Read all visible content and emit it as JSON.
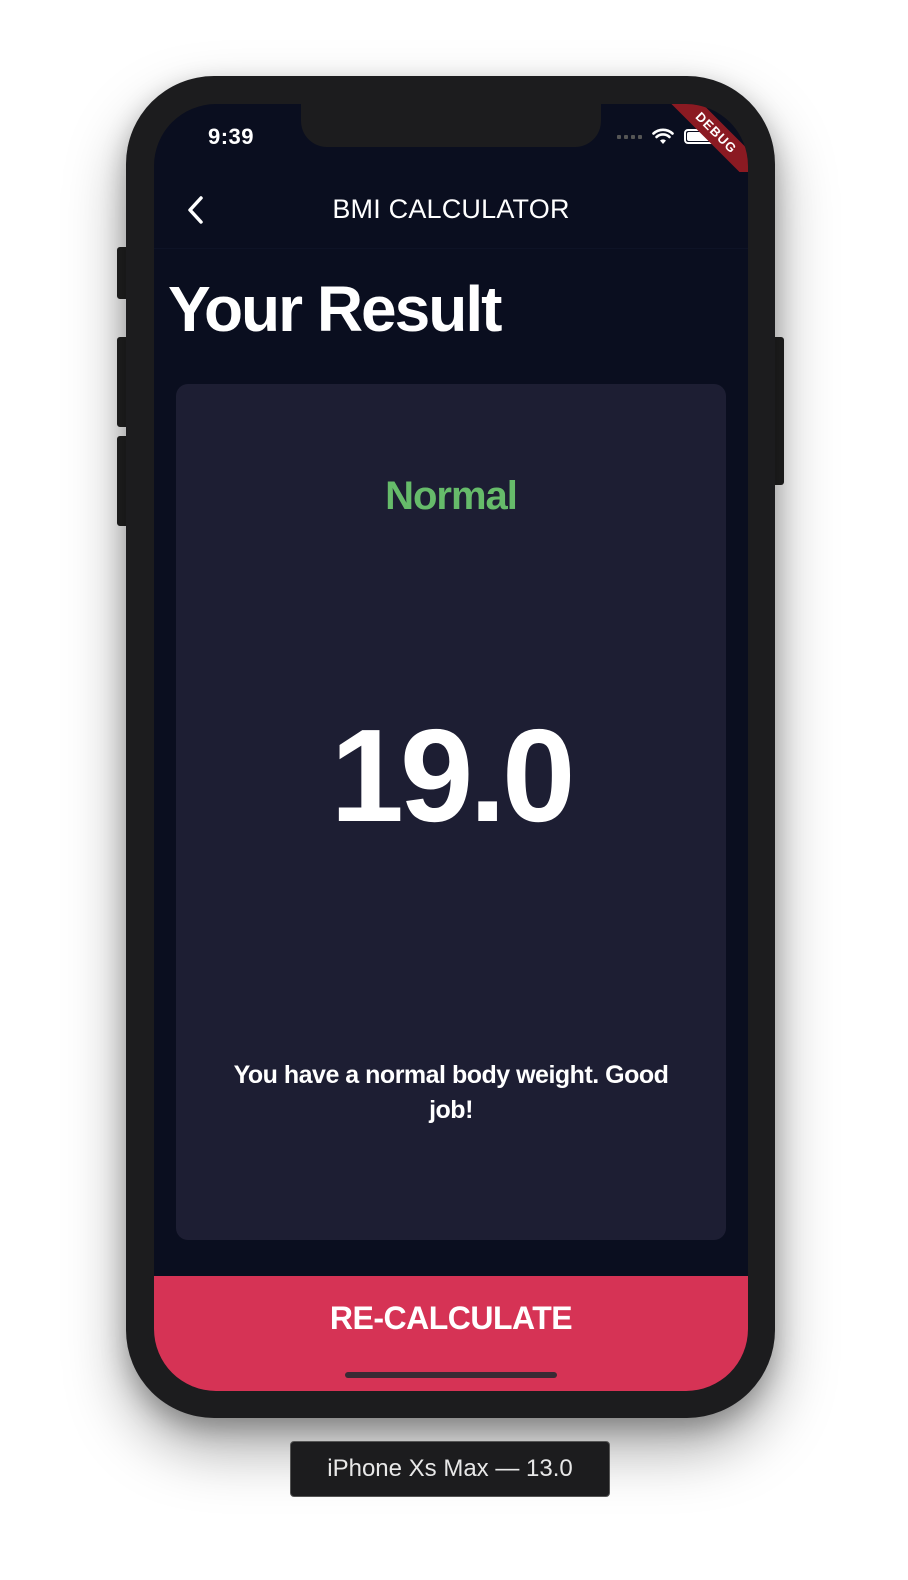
{
  "status_bar": {
    "time": "9:39",
    "debug_banner": "DEBUG"
  },
  "app_bar": {
    "title": "BMI CALCULATOR",
    "back_icon": "chevron-left-icon"
  },
  "page": {
    "title": "Your Result"
  },
  "result": {
    "status": "Normal",
    "value": "19.0",
    "message": "You have a normal body weight. Good job!",
    "status_color": "#66bb6a"
  },
  "action": {
    "recalculate_label": "RE-CALCULATE",
    "color": "#d63355"
  },
  "device": {
    "label": "iPhone Xs Max — 13.0"
  },
  "colors": {
    "background": "#0a0e1f",
    "card": "#1d1e33"
  }
}
